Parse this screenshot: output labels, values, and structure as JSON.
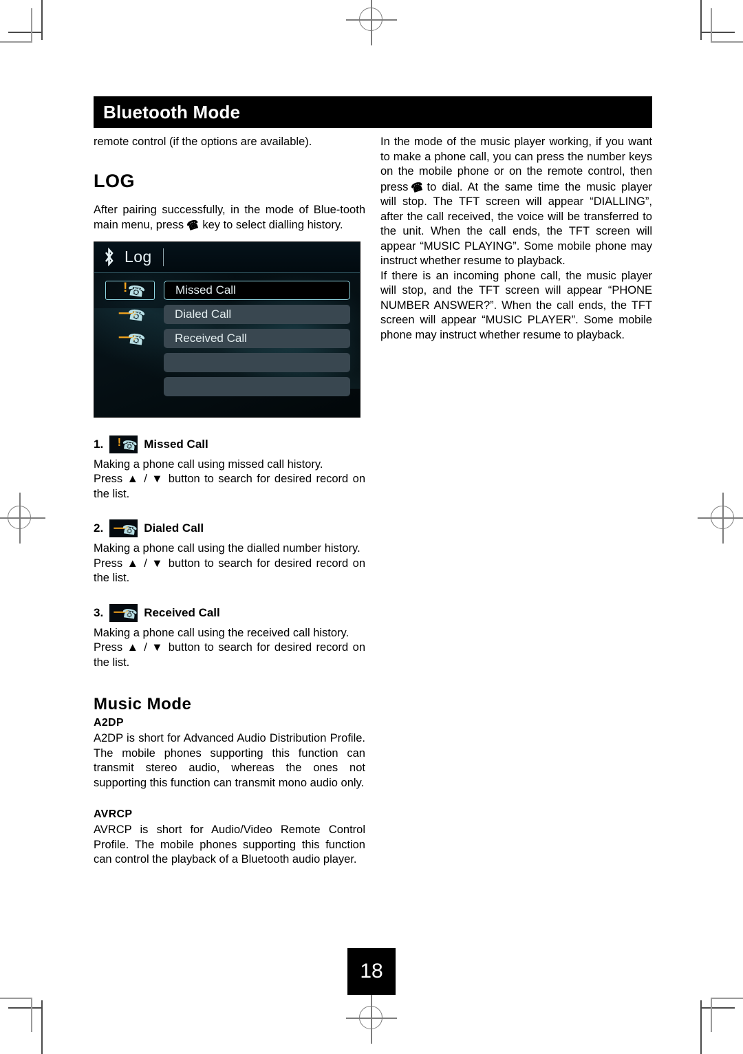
{
  "chapter": {
    "title": "Bluetooth Mode"
  },
  "left_column": {
    "intro": "remote control (if the options are available).",
    "log_heading": "LOG",
    "log_intro_a": "After pairing successfully, in the mode of Blue-tooth main menu, press",
    "log_intro_b": "key to select dialling history.",
    "tft": {
      "title": "Log",
      "bluetooth_icon": "bluetooth-icon",
      "rows": [
        {
          "label": "Missed Call",
          "icon": "missed-call-icon",
          "selected": true
        },
        {
          "label": "Dialed Call",
          "icon": "dialed-call-icon",
          "selected": false
        },
        {
          "label": "Received Call",
          "icon": "received-call-icon",
          "selected": false
        },
        {
          "label": "",
          "icon": "",
          "selected": false
        },
        {
          "label": "",
          "icon": "",
          "selected": false
        }
      ]
    },
    "items": [
      {
        "num": "1.",
        "label": "Missed Call",
        "icon": "missed-call-icon",
        "desc_1": "Making a phone call using missed call history.",
        "desc_2": "Press ▲ / ▼ button to search for desired record on the list."
      },
      {
        "num": "2.",
        "label": "Dialed Call",
        "icon": "dialed-call-icon",
        "desc_1": "Making a phone call using the dialled number history.",
        "desc_2": "Press ▲ / ▼ button to search for desired record on the list."
      },
      {
        "num": "3.",
        "label": "Received Call",
        "icon": "received-call-icon",
        "desc_1": "Making a phone call using the received call history.",
        "desc_2": "Press ▲ / ▼ button to search for desired record on the list."
      }
    ],
    "music_mode_heading": "Music Mode",
    "a2dp_heading": "A2DP",
    "a2dp_body": "A2DP is short for Advanced Audio Distribution Profile. The mobile phones supporting this function can transmit stereo audio, whereas the ones not supporting this function can transmit mono audio only.",
    "avrcp_heading": "AVRCP",
    "avrcp_body": "AVRCP is short for Audio/Video Remote Control Profile. The mobile  phones supporting this function can control the playback of a Bluetooth audio player."
  },
  "right_column": {
    "para1_a": "In the mode of the music player working, if you want to make a phone call, you can press the number keys on the mobile phone or on the remote control, then press",
    "para1_b": "to dial. At the same time the music player will stop. The TFT screen will appear “DIALLING”, after the call received, the voice will be transferred to the unit. When the call ends, the TFT screen will appear “MUSIC PLAYING”. Some mobile phone may instruct whether resume to playback.",
    "para2": "If there is an incoming phone call, the music player will stop, and the TFT screen will appear “PHONE NUMBER ANSWER?”. When the call ends, the TFT screen will appear “MUSIC PLAYER”. Some mobile phone may instruct whether resume to playback."
  },
  "page_number": "18",
  "colors": {
    "chapter_bar_bg": "#000000",
    "tft_accent": "#8fd6e2",
    "tft_row_bg": "#394750",
    "icon_orange": "#f5a51e",
    "icon_handset": "#b9e0e6"
  }
}
